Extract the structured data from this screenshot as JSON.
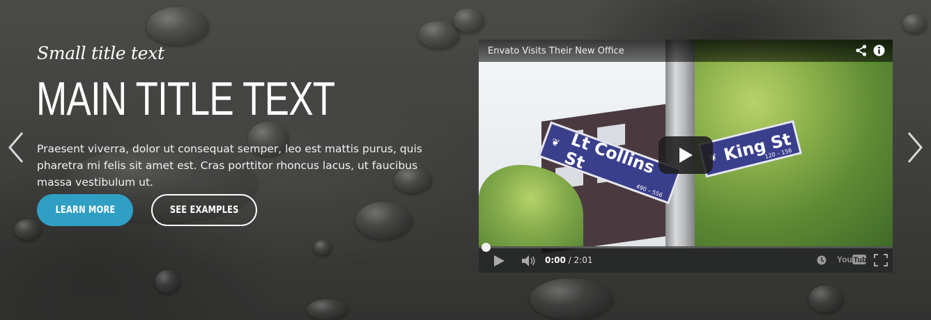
{
  "hero": {
    "small_title": "Small title text",
    "main_title": "MAIN TITLE TEXT",
    "description": "Praesent viverra, dolor ut consequat semper, leo est mattis purus, quis pharetra mi felis sit amet est. Cras porttitor rhoncus lacus, ut faucibus massa vestibulum ut.",
    "buttons": {
      "learn_more": "LEARN MORE",
      "see_examples": "SEE EXAMPLES"
    },
    "accent_color": "#2f9fc4"
  },
  "carousel": {
    "prev_icon": "chevron-left-icon",
    "next_icon": "chevron-right-icon"
  },
  "video": {
    "title": "Envato Visits Their New Office",
    "sign_left": "Lt Collins St",
    "sign_left_sub": "490 – 556",
    "sign_right": "King St",
    "sign_right_sub": "120 – 156",
    "current_time": "0:00",
    "separator": " / ",
    "duration": "2:01",
    "progress_fraction": 0.0,
    "youtube_label": "YouTube",
    "icons": [
      "share-icon",
      "info-icon",
      "play-icon",
      "volume-icon",
      "watch-later-icon",
      "youtube-logo-icon",
      "fullscreen-icon"
    ]
  }
}
